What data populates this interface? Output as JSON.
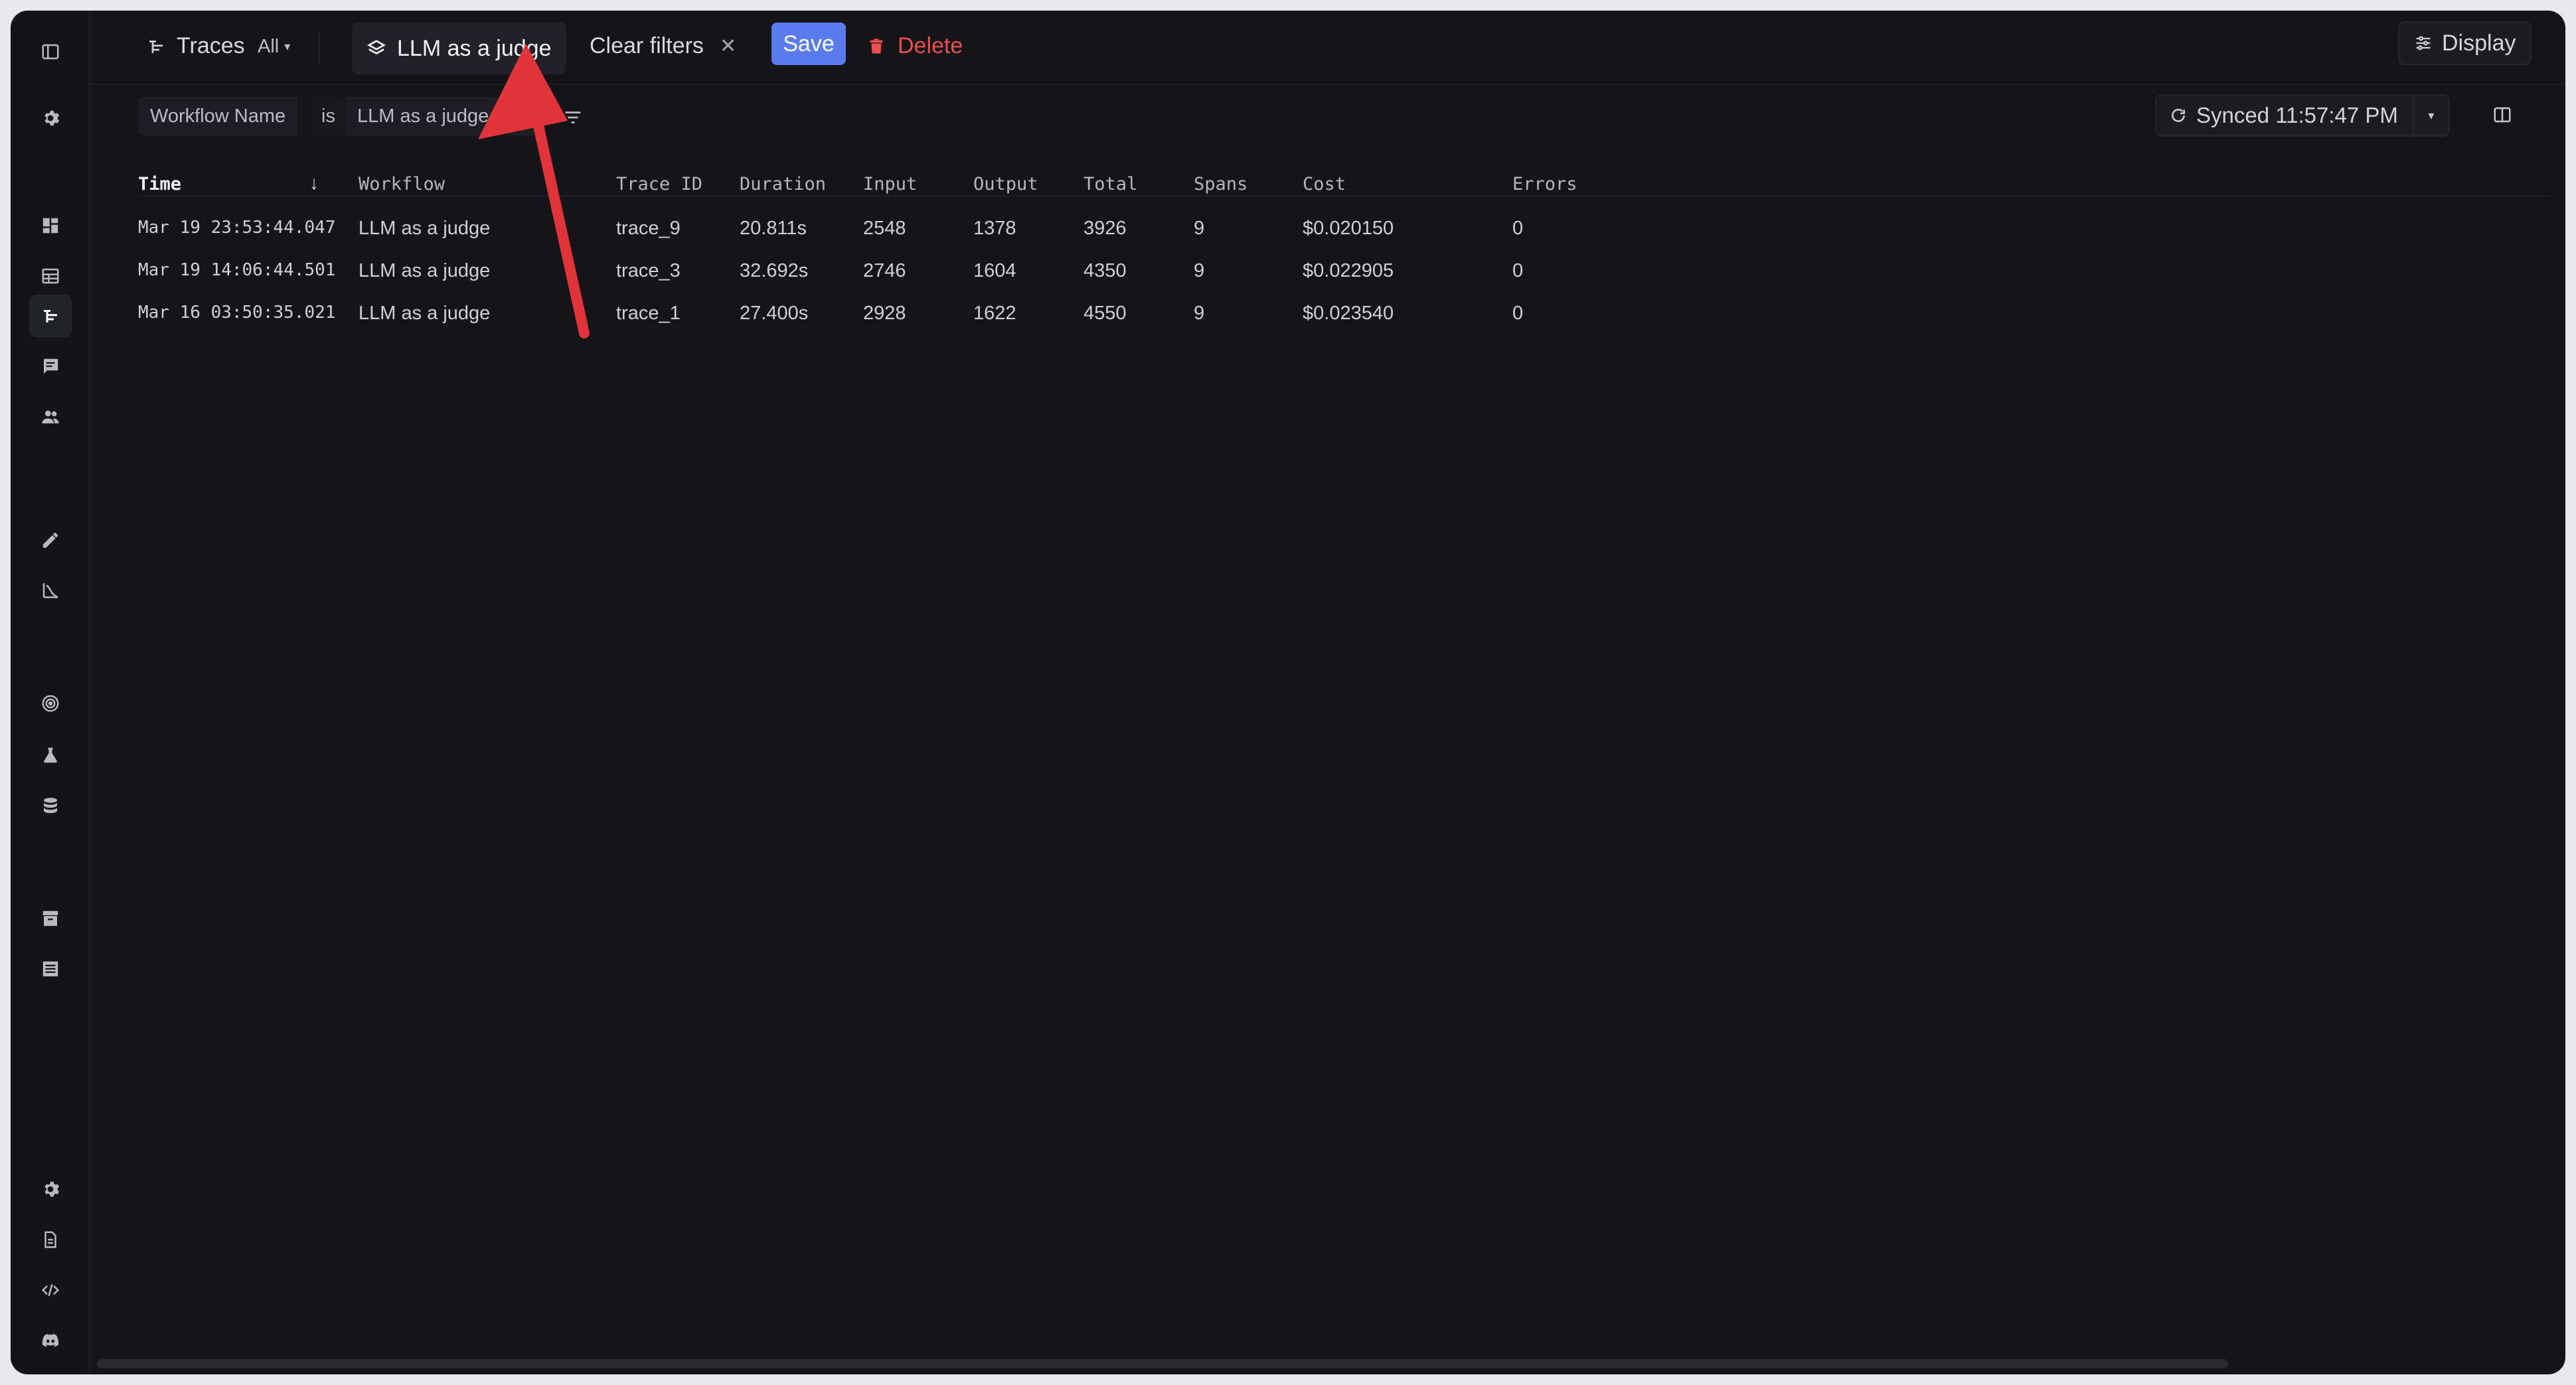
{
  "topbar": {
    "section_title": "Traces",
    "scope_dropdown": "All",
    "view_name": "LLM as a judge",
    "clear_filters_label": "Clear filters",
    "save_label": "Save",
    "delete_label": "Delete",
    "display_label": "Display"
  },
  "filter": {
    "field": "Workflow Name",
    "operator": "is",
    "value": "LLM as a judge",
    "sync_label": "Synced 11:57:47 PM"
  },
  "table": {
    "headers": [
      "Time",
      "Workflow",
      "Trace ID",
      "Duration",
      "Input",
      "Output",
      "Total",
      "Spans",
      "Cost",
      "Errors"
    ],
    "rows": [
      [
        "Mar 19 23:53:44.047",
        "LLM as a judge",
        "trace_9",
        "20.811s",
        "2548",
        "1378",
        "3926",
        "9",
        "$0.020150",
        "0"
      ],
      [
        "Mar 19 14:06:44.501",
        "LLM as a judge",
        "trace_3",
        "32.692s",
        "2746",
        "1604",
        "4350",
        "9",
        "$0.022905",
        "0"
      ],
      [
        "Mar 16 03:50:35.021",
        "LLM as a judge",
        "trace_1",
        "27.400s",
        "2928",
        "1622",
        "4550",
        "9",
        "$0.023540",
        "0"
      ]
    ]
  },
  "colors": {
    "background": "#151518",
    "accent": "#5b7cf0",
    "danger": "#ef4f4f",
    "annotation_arrow": "#e0343a"
  },
  "sidebar": {
    "icons": [
      "panel-toggle-icon",
      "settings-icon",
      "dashboard-icon",
      "table-icon",
      "traces-icon",
      "chat-icon",
      "users-icon",
      "edit-icon",
      "chart-icon",
      "target-icon",
      "flask-icon",
      "database-icon",
      "archive-icon",
      "list-icon",
      "settings-icon",
      "document-icon",
      "code-icon",
      "discord-icon"
    ]
  }
}
